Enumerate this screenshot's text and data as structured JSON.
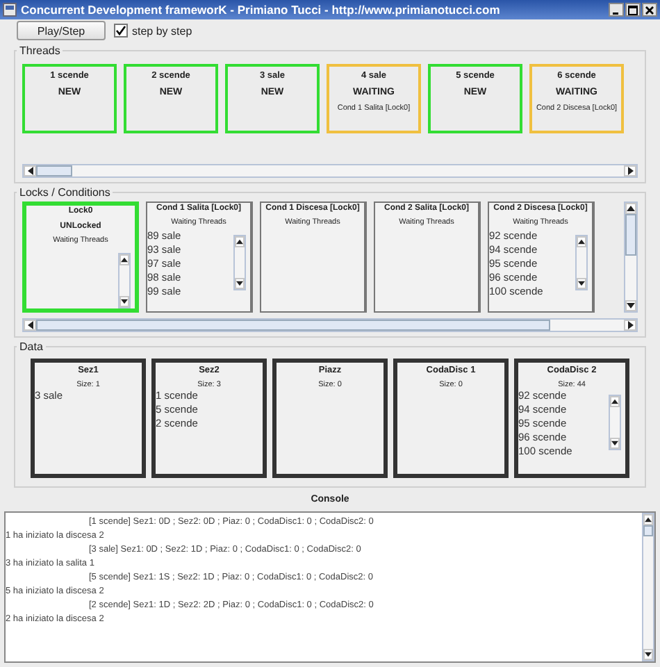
{
  "window": {
    "title": "Concurrent Development frameworK   -   Primiano Tucci - http://www.primianotucci.com"
  },
  "toolbar": {
    "play_button": "Play/Step",
    "step_checkbox": {
      "label": "step by step",
      "checked": true
    }
  },
  "threads": {
    "title": "Threads",
    "items": [
      {
        "name": "1 scende",
        "status": "NEW",
        "kind": "new"
      },
      {
        "name": "2 scende",
        "status": "NEW",
        "kind": "new"
      },
      {
        "name": "3 sale",
        "status": "NEW",
        "kind": "new"
      },
      {
        "name": "4 sale",
        "status": "WAITING",
        "kind": "waiting",
        "detail": "Cond 1 Salita [Lock0]"
      },
      {
        "name": "5 scende",
        "status": "NEW",
        "kind": "new"
      },
      {
        "name": "6 scende",
        "status": "WAITING",
        "kind": "waiting",
        "detail": "Cond 2 Discesa [Lock0]"
      }
    ]
  },
  "locks": {
    "title": "Locks / Conditions",
    "items": [
      {
        "kind": "lock",
        "name": "Lock0",
        "status": "UNLocked",
        "waiting_label": "Waiting Threads"
      },
      {
        "kind": "condition",
        "name": "Cond 1 Salita [Lock0]",
        "waiting_label": "Waiting Threads",
        "threads": [
          "89 sale",
          "93 sale",
          "97 sale",
          "98 sale",
          "99 sale"
        ]
      },
      {
        "kind": "condition",
        "name": "Cond 1 Discesa [Lock0]",
        "waiting_label": "Waiting Threads"
      },
      {
        "kind": "condition",
        "name": "Cond 2 Salita [Lock0]",
        "waiting_label": "Waiting Threads"
      },
      {
        "kind": "condition",
        "name": "Cond 2 Discesa [Lock0]",
        "waiting_label": "Waiting Threads",
        "threads": [
          "92 scende",
          "94 scende",
          "95 scende",
          "96 scende",
          "100 scende"
        ]
      }
    ]
  },
  "data": {
    "title": "Data",
    "items": [
      {
        "name": "Sez1",
        "size": "Size: 1",
        "items": [
          "3 sale"
        ]
      },
      {
        "name": "Sez2",
        "size": "Size: 3",
        "items": [
          "1 scende",
          "5 scende",
          "2 scende"
        ]
      },
      {
        "name": "Piazz",
        "size": "Size: 0"
      },
      {
        "name": "CodaDisc 1",
        "size": "Size: 0"
      },
      {
        "name": "CodaDisc 2",
        "size": "Size: 44",
        "items": [
          "92 scende",
          "94 scende",
          "95 scende",
          "96 scende",
          "100 scende"
        ],
        "scrollable": true
      }
    ]
  },
  "console": {
    "title": "Console",
    "lines": [
      {
        "kind": "state",
        "text": "[1 scende] Sez1: 0D  ; Sez2: 0D ; Piaz: 0 ; CodaDisc1: 0 ; CodaDisc2: 0"
      },
      {
        "kind": "event",
        "text": "1 ha iniziato la discesa 2"
      },
      {
        "kind": "state",
        "text": "[3 sale] Sez1: 0D  ; Sez2: 1D ; Piaz: 0 ; CodaDisc1: 0 ; CodaDisc2: 0"
      },
      {
        "kind": "event",
        "text": "3 ha iniziato la salita 1"
      },
      {
        "kind": "state",
        "text": "[5 scende] Sez1: 1S  ; Sez2: 1D ; Piaz: 0 ; CodaDisc1: 0 ; CodaDisc2: 0"
      },
      {
        "kind": "event",
        "text": "5 ha iniziato la discesa 2"
      },
      {
        "kind": "state",
        "text": "[2 scende] Sez1: 1D  ; Sez2: 2D ; Piaz: 0 ; CodaDisc1: 0 ; CodaDisc2: 0"
      },
      {
        "kind": "event",
        "text": "2 ha iniziato la discesa 2"
      }
    ]
  }
}
